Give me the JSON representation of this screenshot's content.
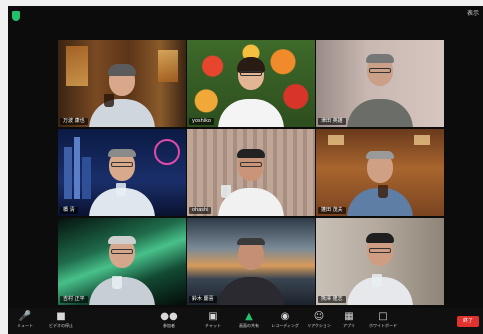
{
  "window": {
    "view_button": "表示"
  },
  "participants": [
    {
      "id": "p1",
      "name": "万波 康也",
      "bg": "bar"
    },
    {
      "id": "p2",
      "name": "yoshiko",
      "bg": "flowers",
      "speaking": true
    },
    {
      "id": "p3",
      "name": "津田 英雄",
      "bg": "wall"
    },
    {
      "id": "p4",
      "name": "橋 清",
      "bg": "city"
    },
    {
      "id": "p5",
      "name": "ohashi",
      "bg": "curtain"
    },
    {
      "id": "p6",
      "name": "蓬田 茂夫",
      "bg": "restaurant"
    },
    {
      "id": "p7",
      "name": "吉村 正平",
      "bg": "aurora"
    },
    {
      "id": "p8",
      "name": "鈴木 慶喜",
      "bg": "sunset"
    },
    {
      "id": "p9",
      "name": "熊澤 隆志",
      "bg": "room"
    }
  ],
  "toolbar": {
    "mute": "ミュート",
    "video": "ビデオの停止",
    "participants": "参加者",
    "participants_count": "9",
    "chat": "チャット",
    "share": "画面の共有",
    "record": "レコーディング",
    "reactions": "リアクション",
    "apps": "アプリ",
    "whiteboard": "ホワイトボード",
    "end": "終了"
  },
  "colors": {
    "app_bg": "#0c0c0c",
    "speaker_border": "#e7d33a",
    "share_green": "#27c06a",
    "end_red": "#e0322f",
    "security_green": "#23c16b"
  },
  "icons": {
    "security": "shield-icon",
    "mute": "microphone-icon",
    "video": "video-camera-icon",
    "participants": "people-icon",
    "chat": "chat-bubble-icon",
    "share": "share-screen-icon",
    "record": "record-icon",
    "reactions": "emoji-icon",
    "apps": "apps-icon",
    "whiteboard": "whiteboard-icon"
  }
}
